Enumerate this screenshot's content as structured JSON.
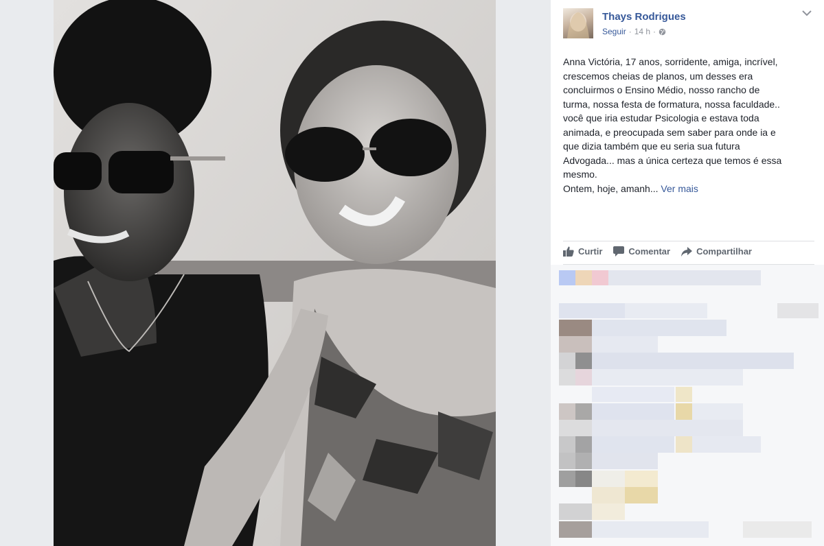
{
  "post": {
    "author": "Thays Rodrigues",
    "follow": "Seguir",
    "separator": "·",
    "time": "14 h",
    "privacy_icon": "globe-icon",
    "lines": [
      "Anna Victória, 17 anos, sorridente, amiga, incrível,",
      "crescemos cheias de planos, um desses era",
      "concluirmos o Ensino Médio, nosso rancho de",
      "turma, nossa festa de formatura, nossa faculdade..",
      "você que iria estudar Psicologia e estava toda",
      "animada, e preocupada sem saber para onde ia e",
      "que dizia também que eu seria sua futura",
      "Advogada... mas a única certeza que temos é essa",
      "mesmo."
    ],
    "last_line": "Ontem, hoje, amanh...",
    "see_more": "Ver mais"
  },
  "actions": {
    "like": "Curtir",
    "comment": "Comentar",
    "share": "Compartilhar"
  },
  "colors": {
    "link": "#365899",
    "text": "#1d2129",
    "muted": "#90949c",
    "page_bg": "#e9ebee"
  }
}
